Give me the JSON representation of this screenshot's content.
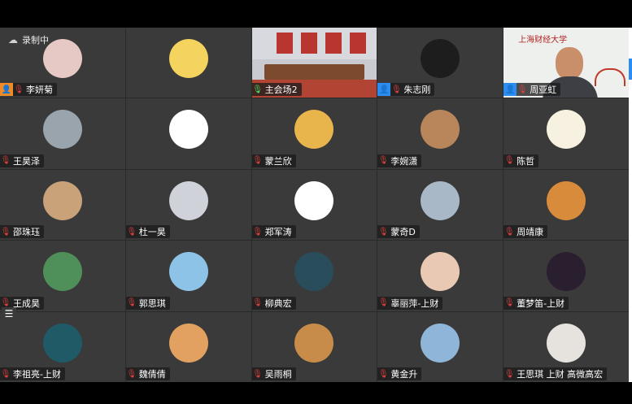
{
  "recording": {
    "label": "录制中",
    "icon": "cloud-icon"
  },
  "tiles": [
    {
      "name": "李妍菊",
      "mic": "muted",
      "host": "orange",
      "avatar": {
        "bg": "#e6c9c4",
        "fg": "#7a2e2e",
        "glyph": ""
      }
    },
    {
      "name": "",
      "mic": "none",
      "host": "",
      "avatar": {
        "bg": "#f4d35e",
        "fg": "#333333",
        "glyph": ""
      }
    },
    {
      "name": "主会场2",
      "mic": "on",
      "host": "",
      "video": "meeting-room"
    },
    {
      "name": "朱志刚",
      "mic": "muted",
      "host": "blue",
      "avatar": {
        "bg": "#1d1d1d",
        "fg": "#c0392b",
        "glyph": ""
      }
    },
    {
      "name": "周亚虹",
      "mic": "muted",
      "host": "blue",
      "video": "person-cam",
      "logo": "上海财经大学"
    },
    {
      "name": "王昊泽",
      "mic": "muted",
      "host": "",
      "avatar": {
        "bg": "#9aa4ad",
        "fg": "#ffffff",
        "glyph": ""
      }
    },
    {
      "name": "",
      "mic": "none",
      "host": "",
      "avatar": {
        "bg": "#ffffff",
        "fg": "#111111",
        "glyph": ""
      }
    },
    {
      "name": "蒙兰欣",
      "mic": "muted",
      "host": "",
      "avatar": {
        "bg": "#e8b44c",
        "fg": "#ffffff",
        "glyph": ""
      }
    },
    {
      "name": "李婉潇",
      "mic": "muted",
      "host": "",
      "avatar": {
        "bg": "#b8865a",
        "fg": "#ffffff",
        "glyph": ""
      }
    },
    {
      "name": "陈哲",
      "mic": "muted",
      "host": "",
      "avatar": {
        "bg": "#f7f1e1",
        "fg": "#c98f45",
        "glyph": ""
      }
    },
    {
      "name": "邵珠珏",
      "mic": "muted",
      "host": "",
      "avatar": {
        "bg": "#c9a27a",
        "fg": "#ffffff",
        "glyph": ""
      }
    },
    {
      "name": "杜一昊",
      "mic": "muted",
      "host": "",
      "avatar": {
        "bg": "#cfd2d8",
        "fg": "#555555",
        "glyph": ""
      }
    },
    {
      "name": "郑军涛",
      "mic": "muted",
      "host": "",
      "avatar": {
        "bg": "#ffffff",
        "fg": "#333333",
        "glyph": ""
      }
    },
    {
      "name": "蒙奇D",
      "mic": "muted",
      "host": "",
      "avatar": {
        "bg": "#a9b8c7",
        "fg": "#222222",
        "glyph": ""
      }
    },
    {
      "name": "周靖康",
      "mic": "muted",
      "host": "",
      "avatar": {
        "bg": "#d88b3a",
        "fg": "#ffffff",
        "glyph": ""
      }
    },
    {
      "name": "王成昊",
      "mic": "muted",
      "host": "",
      "avatar": {
        "bg": "#4f8f5a",
        "fg": "#ffffff",
        "glyph": ""
      }
    },
    {
      "name": "郭思琪",
      "mic": "muted",
      "host": "",
      "avatar": {
        "bg": "#8ec3e8",
        "fg": "#2e6b3a",
        "glyph": ""
      }
    },
    {
      "name": "柳典宏",
      "mic": "muted",
      "host": "",
      "avatar": {
        "bg": "#2a4d5c",
        "fg": "#9fe3f0",
        "glyph": ""
      }
    },
    {
      "name": "辜丽萍-上财",
      "mic": "muted",
      "host": "",
      "avatar": {
        "bg": "#e9c8b4",
        "fg": "#8a5a3c",
        "glyph": ""
      }
    },
    {
      "name": "董梦笛-上财",
      "mic": "muted",
      "host": "",
      "avatar": {
        "bg": "#2a1f2e",
        "fg": "#e04a6a",
        "glyph": ""
      }
    },
    {
      "name": "李祖亮-上财",
      "mic": "muted",
      "host": "",
      "avatar": {
        "bg": "#1f5a66",
        "fg": "#bfe7ee",
        "glyph": ""
      }
    },
    {
      "name": "魏倩倩",
      "mic": "muted",
      "host": "",
      "avatar": {
        "bg": "#e2a160",
        "fg": "#ffffff",
        "glyph": ""
      }
    },
    {
      "name": "吴雨桐",
      "mic": "muted",
      "host": "",
      "avatar": {
        "bg": "#c88c4a",
        "fg": "#ffffff",
        "glyph": ""
      }
    },
    {
      "name": "黄金升",
      "mic": "muted",
      "host": "",
      "avatar": {
        "bg": "#8fb6d8",
        "fg": "#3a4a3a",
        "glyph": ""
      }
    },
    {
      "name": "王思琪 上财 高微高宏",
      "mic": "muted",
      "host": "",
      "avatar": {
        "bg": "#e6e3de",
        "fg": "#333333",
        "glyph": ""
      }
    }
  ],
  "menu_glyph": "☰",
  "icons": {
    "mic_muted": "mic-muted-icon",
    "mic_on": "mic-icon",
    "host": "person-icon",
    "menu": "menu-icon"
  }
}
